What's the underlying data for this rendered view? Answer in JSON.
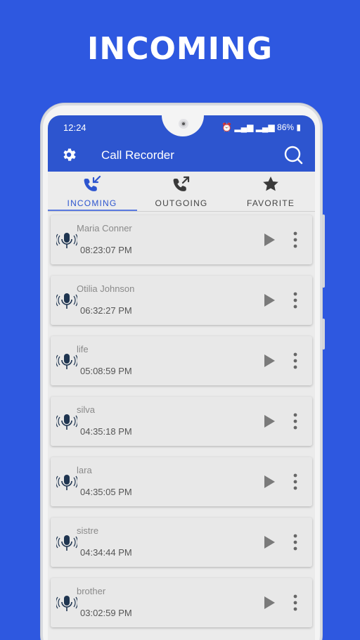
{
  "promo": {
    "title": "INCOMING"
  },
  "status_bar": {
    "time": "12:24",
    "battery": "86%"
  },
  "app_bar": {
    "title": "Call Recorder",
    "settings_icon": "gear-icon",
    "search_icon": "search-icon"
  },
  "tabs": [
    {
      "label": "INCOMING",
      "icon": "incoming-call-icon",
      "active": true
    },
    {
      "label": "OUTGOING",
      "icon": "outgoing-call-icon",
      "active": false
    },
    {
      "label": "FAVORITE",
      "icon": "star-icon",
      "active": false
    }
  ],
  "recordings": [
    {
      "name": "Maria Conner",
      "time": "08:23:07 PM"
    },
    {
      "name": "Otilia Johnson",
      "time": "06:32:27 PM"
    },
    {
      "name": "life",
      "time": "05:08:59 PM"
    },
    {
      "name": "silva",
      "time": "04:35:18 PM"
    },
    {
      "name": "lara",
      "time": "04:35:05 PM"
    },
    {
      "name": "sistre",
      "time": "04:34:44 PM"
    },
    {
      "name": "brother",
      "time": "03:02:59 PM"
    }
  ],
  "colors": {
    "background": "#2e58e0",
    "app_bar": "#2d55cf",
    "accent": "#2d55cf"
  }
}
